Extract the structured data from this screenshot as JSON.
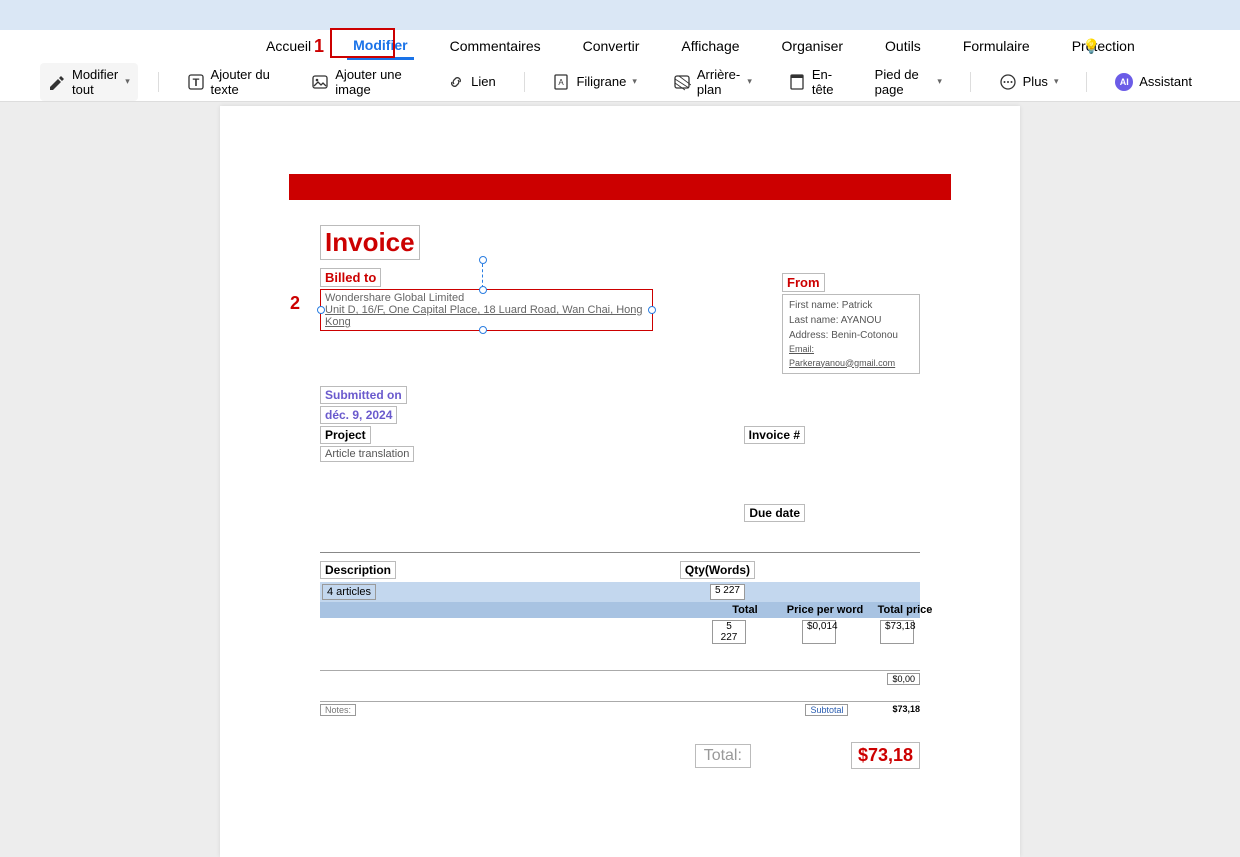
{
  "menu": {
    "accueil": "Accueil",
    "modifier": "Modifier",
    "commentaires": "Commentaires",
    "convertir": "Convertir",
    "affichage": "Affichage",
    "organiser": "Organiser",
    "outils": "Outils",
    "formulaire": "Formulaire",
    "protection": "Protection"
  },
  "annotations": {
    "one": "1",
    "two": "2"
  },
  "toolbar": {
    "modifier_tout": "Modifier tout",
    "ajouter_texte": "Ajouter du texte",
    "ajouter_image": "Ajouter une image",
    "lien": "Lien",
    "filigrane": "Filigrane",
    "arriere_plan": "Arrière-plan",
    "en_tete": "En-tête",
    "pied_de_page": "Pied de page",
    "plus": "Plus",
    "assistant": "Assistant"
  },
  "doc": {
    "invoice_title": "Invoice",
    "billed_to": "Billed to",
    "billed_company": "Wondershare Global Limited",
    "billed_address": "Unit D, 16/F, One Capital Place, 18 Luard Road, Wan Chai, Hong Kong",
    "from_label": "From",
    "from_first": "First name: Patrick",
    "from_last": "Last name: AYANOU",
    "from_addr": "Address: Benin-Cotonou",
    "from_email": "Email: Parkerayanou@gmail.com",
    "submitted_on": "Submitted on",
    "submitted_date": "déc. 9, 2024",
    "project_label": "Project",
    "project_val": "Article translation",
    "invoice_num_label": "Invoice #",
    "due_date_label": "Due date",
    "desc_header": "Description",
    "qty_header": "Qty(Words)",
    "item_desc": "4 articles",
    "item_qty": "5 227",
    "col_total": "Total",
    "col_ppw": "Price per word",
    "col_tprice": "Total price",
    "val_total": "5 227",
    "val_ppw": "$0,014",
    "val_tprice": "$73,18",
    "zero": "$0,00",
    "notes": "Notes:",
    "subtotal": "Subtotal",
    "subtotal_val": "$73,18",
    "total_label": "Total:",
    "total_val": "$73,18"
  }
}
